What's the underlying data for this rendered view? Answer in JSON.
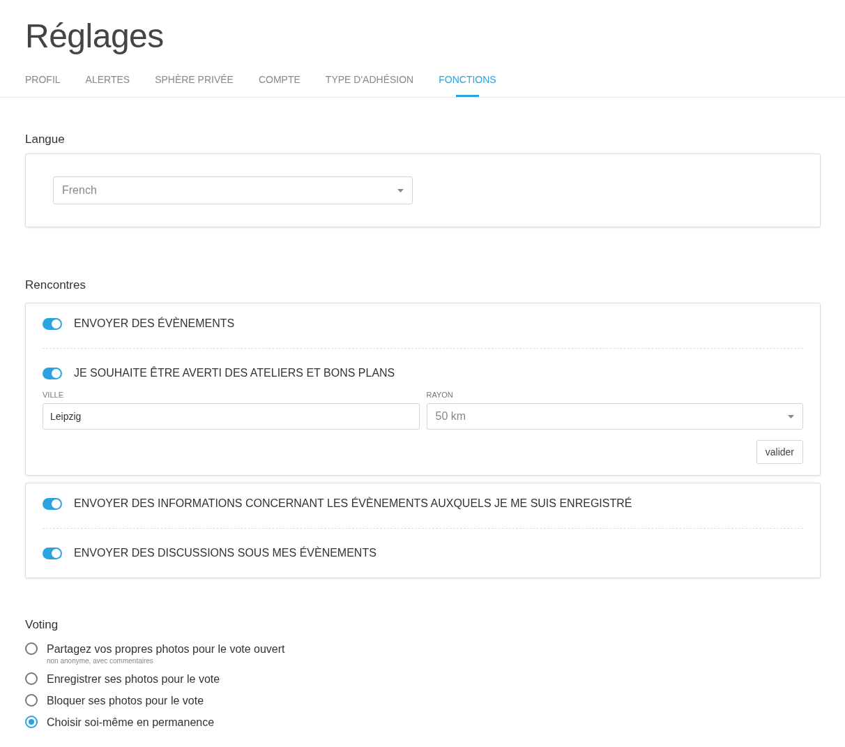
{
  "title": "Réglages",
  "tabs": [
    {
      "label": "PROFIL",
      "selected": false
    },
    {
      "label": "ALERTES",
      "selected": false
    },
    {
      "label": "SPHÈRE PRIVÉE",
      "selected": false
    },
    {
      "label": "COMPTE",
      "selected": false
    },
    {
      "label": "TYPE D'ADHÉSION",
      "selected": false
    },
    {
      "label": "FONCTIONS",
      "selected": true
    }
  ],
  "language": {
    "heading": "Langue",
    "select": {
      "value": "French"
    }
  },
  "meetings": {
    "heading": "Rencontres",
    "cards": [
      {
        "items": [
          {
            "kind": "toggle",
            "label": "ENVOYER DES ÉVÈNEMENTS",
            "on": true
          },
          {
            "kind": "toggle",
            "label": "JE SOUHAITE ÊTRE AVERTI DES ATELIERS ET BONS PLANS",
            "on": true
          },
          {
            "kind": "fields",
            "city": {
              "label": "VILLE",
              "value": "Leipzig"
            },
            "radius": {
              "label": "RAYON",
              "value": "50 km"
            },
            "button": "valider"
          }
        ]
      },
      {
        "items": [
          {
            "kind": "toggle",
            "label": "ENVOYER DES INFORMATIONS CONCERNANT LES ÉVÈNEMENTS AUXQUELS JE ME SUIS ENREGISTRÉ",
            "on": true
          },
          {
            "kind": "toggle",
            "label": "ENVOYER DES DISCUSSIONS SOUS MES ÉVÈNEMENTS",
            "on": true
          }
        ]
      }
    ]
  },
  "voting": {
    "heading": "Voting",
    "options": [
      {
        "label": "Partagez vos propres photos pour le vote ouvert",
        "hint": "non anonyme, avec commentaires",
        "selected": false
      },
      {
        "label": "Enregistrer ses photos pour le vote",
        "selected": false
      },
      {
        "label": "Bloquer ses photos pour le vote",
        "selected": false
      },
      {
        "label": "Choisir soi-même en permanence",
        "selected": true
      }
    ]
  }
}
